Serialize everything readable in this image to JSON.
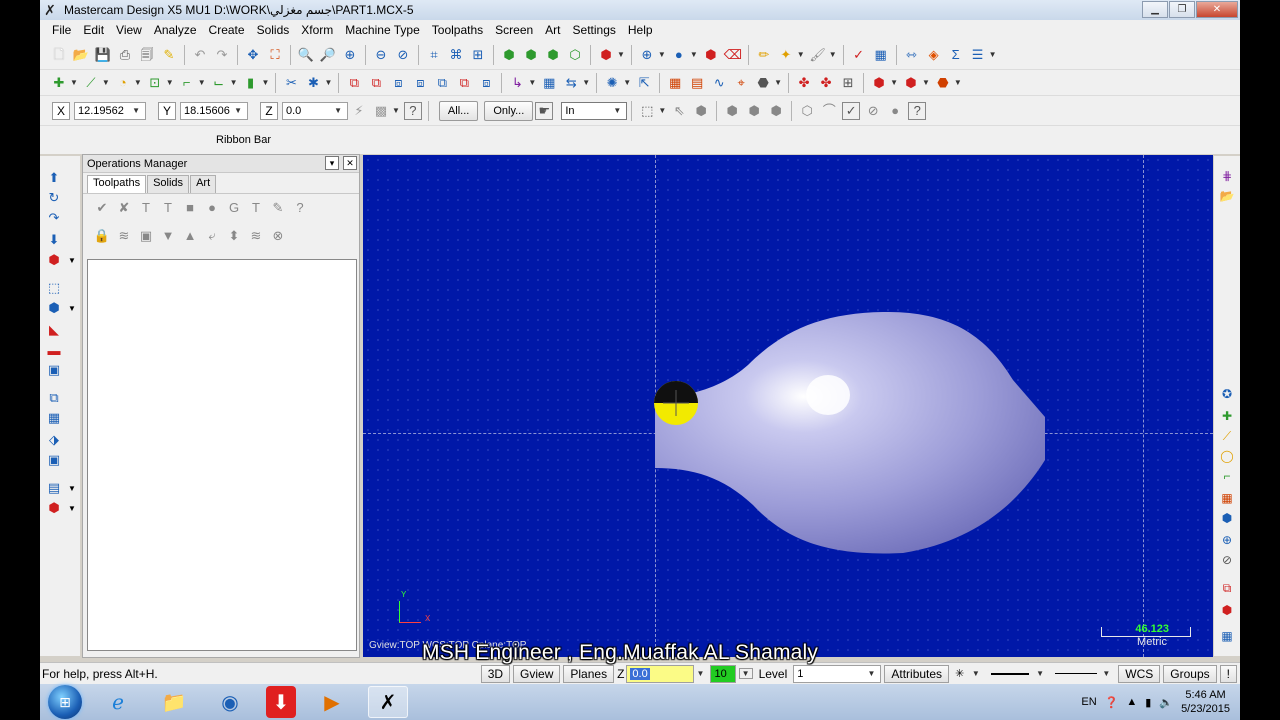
{
  "window": {
    "title": "Mastercam Design X5 MU1  D:\\WORK\\جسم مغزلي\\PART1.MCX-5",
    "minimize": "▁",
    "maximize": "❐",
    "close": "✕"
  },
  "menu": [
    "File",
    "Edit",
    "View",
    "Analyze",
    "Create",
    "Solids",
    "Xform",
    "Machine Type",
    "Toolpaths",
    "Screen",
    "Art",
    "Settings",
    "Help"
  ],
  "coords": {
    "x_label": "X",
    "x_value": "12.19562",
    "y_label": "Y",
    "y_value": "18.15606",
    "z_label": "Z",
    "z_value": "0.0"
  },
  "selection": {
    "all_button": "All...",
    "only_button": "Only...",
    "unit_value": "In"
  },
  "ribbon": {
    "label": "Ribbon Bar"
  },
  "operations_manager": {
    "title": "Operations Manager",
    "pin": "▾",
    "close": "✕",
    "tabs": [
      "Toolpaths",
      "Solids",
      "Art"
    ],
    "active_tab": "Toolpaths"
  },
  "viewport": {
    "view_status": "Gview:TOP   WCS:TOP   Cplane:TOP",
    "scale_value": "46.123",
    "scale_unit": "Metric",
    "axis_x": "X",
    "axis_y": "Y",
    "background": "#0018a8"
  },
  "caption": "MSH Engineer , Eng.Muaffak AL Shamaly",
  "statusbar": {
    "help": "For help, press Alt+H.",
    "view_3d": "3D",
    "gview": "Gview",
    "planes": "Planes",
    "z_label": "Z",
    "z_value": "0.0",
    "color_value": "10",
    "level_label": "Level",
    "level_value": "1",
    "attributes": "Attributes",
    "wcs": "WCS",
    "groups": "Groups",
    "excl": "!"
  },
  "taskbar": {
    "language": "EN",
    "time": "5:46 AM",
    "date": "5/23/2015"
  }
}
